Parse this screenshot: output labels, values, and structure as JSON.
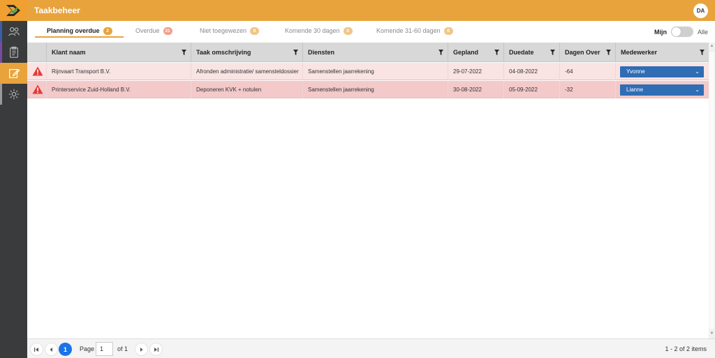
{
  "app": {
    "title": "Taakbeheer",
    "user_initials": "DA"
  },
  "sidebar": {
    "items": [
      {
        "name": "users-icon",
        "stripe": "#3a5fa8"
      },
      {
        "name": "clipboard-icon",
        "stripe": "#7a4aa0"
      },
      {
        "name": "edit-icon",
        "stripe": "#e8a33c",
        "active": true
      },
      {
        "name": "gear-icon",
        "stripe": "#9a9a9a"
      }
    ]
  },
  "tabs": [
    {
      "label": "Planning overdue",
      "count": "2",
      "badge_color": "#e8a33c",
      "active": true
    },
    {
      "label": "Overdue",
      "count": "21",
      "badge_color": "#f0a08a"
    },
    {
      "label": "Niet toegewezen",
      "count": "0",
      "badge_color": "#f0c68a"
    },
    {
      "label": "Komende 30 dagen",
      "count": "0",
      "badge_color": "#f0c68a"
    },
    {
      "label": "Komende 31-60 dagen",
      "count": "0",
      "badge_color": "#f0c68a"
    }
  ],
  "toggle": {
    "left_label": "Mijn",
    "right_label": "Alle",
    "state": "Mijn"
  },
  "grid": {
    "columns": [
      "Klant naam",
      "Taak omschrijving",
      "Diensten",
      "Gepland",
      "Duedate",
      "Dagen Over",
      "Medewerker"
    ],
    "rows": [
      {
        "client": "Rijnvaart Transport B.V.",
        "task": "Afronden administratie/ samensteldossier",
        "service": "Samenstellen jaarrekening",
        "planned": "29-07-2022",
        "due": "04-08-2022",
        "days_over": "-64",
        "employee": "Yvonne",
        "row_color": "#f9e3e3"
      },
      {
        "client": "Printerservice Zuid-Holland B.V.",
        "task": "Deponeren KVK + notulen",
        "service": "Samenstellen jaarrekening",
        "planned": "30-08-2022",
        "due": "05-09-2022",
        "days_over": "-32",
        "employee": "Lianne",
        "row_color": "#f3c9c9"
      }
    ]
  },
  "pager": {
    "current_page": "1",
    "page_label": "Page",
    "page_input": "1",
    "of_label": "of 1",
    "summary": "1 - 2 of 2 items"
  },
  "colors": {
    "accent": "#e8a33c",
    "sidebar": "#3a3b3d",
    "select_blue": "#2f6db5",
    "warning_red": "#e53935"
  }
}
